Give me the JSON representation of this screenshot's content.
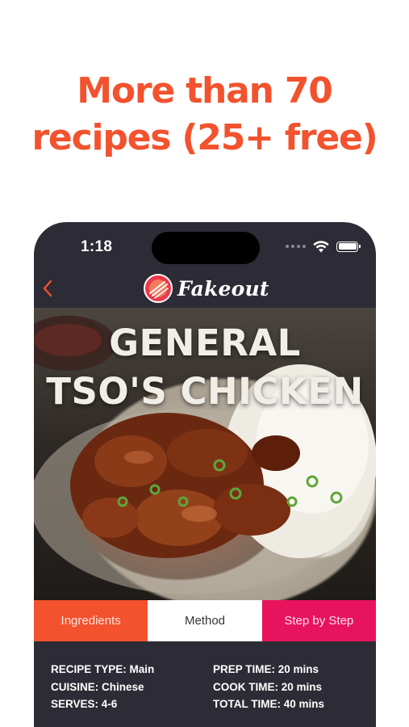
{
  "headline": {
    "line1": "More than 70",
    "line2": "recipes (25+ free)"
  },
  "status_bar": {
    "time": "1:18",
    "icons": [
      "signal-dots-icon",
      "wifi-icon",
      "battery-icon"
    ]
  },
  "nav": {
    "back_icon": "chevron-left-icon",
    "logo_icon": "fakeout-logo-icon",
    "brand_name": "Fakeout"
  },
  "hero": {
    "title_line1": "GENERAL",
    "title_line2": "TSO'S CHICKEN"
  },
  "tabs": [
    {
      "label": "Ingredients",
      "color": "#f2522e"
    },
    {
      "label": "Method",
      "color": "#ffffff",
      "selected": true
    },
    {
      "label": "Step by Step",
      "color": "#e8135d"
    }
  ],
  "recipe_info": {
    "type": "RECIPE TYPE: Main",
    "cuisine": "CUISINE: Chinese",
    "serves": "SERVES: 4-6",
    "prep": "PREP TIME: 20 mins",
    "cook": "COOK TIME: 20 mins",
    "total": "TOTAL TIME: 40 mins"
  },
  "colors": {
    "accent": "#f2522e",
    "brand_pink": "#e8135d",
    "phone_bg": "#2d2b35"
  }
}
